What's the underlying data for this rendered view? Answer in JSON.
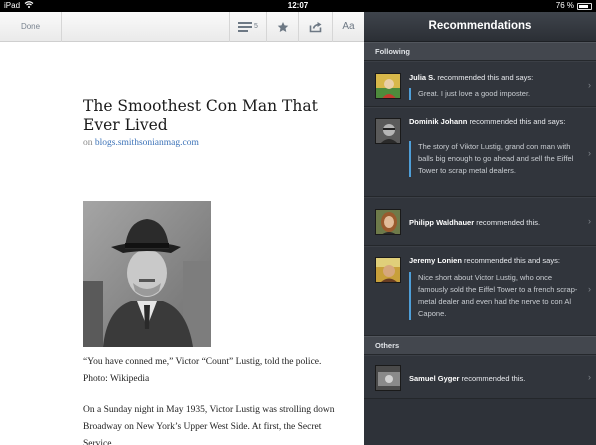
{
  "status_bar": {
    "device": "iPad",
    "time": "12:07",
    "battery": "76 %"
  },
  "toolbar": {
    "done_label": "Done",
    "list_count": "5",
    "font_label": "Aa"
  },
  "article": {
    "title": "The Smoothest Con Man That Ever Lived",
    "source_prefix": "on",
    "source_domain": "blogs.smithsonianmag.com",
    "caption": "“You have conned me,” Victor “Count” Lustig, told the police. Photo: Wikipedia",
    "body": "On a Sunday night in May 1935, Victor Lustig was strolling down Broadway on New York’s Upper West Side. At first, the Secret Service"
  },
  "recommendations": {
    "header": "Recommendations",
    "following_label": "Following",
    "others_label": "Others",
    "following": [
      {
        "name": "Julia S.",
        "action": "recommended this and says:",
        "quote": "Great. I just love a good imposter."
      },
      {
        "name": "Dominik Johann",
        "action": "recommended this and says:",
        "quote": "The story of Viktor Lustig, grand con man with balls big enough to go ahead and sell the Eiffel Tower to scrap metal dealers."
      },
      {
        "name": "Philipp Waldhauer",
        "action": "recommended this.",
        "quote": ""
      },
      {
        "name": "Jeremy Lonien",
        "action": "recommended this and says:",
        "quote": "Nice short about Victor Lustig, who once famously sold the Eiffel Tower to a french scrap-metal dealer and even had the nerve to con Al Capone."
      }
    ],
    "others": [
      {
        "name": "Samuel Gyger",
        "action": "recommended this."
      }
    ]
  },
  "icons": {
    "wifi": "wifi-icon",
    "list": "list-icon",
    "star": "star-icon",
    "share": "share-icon",
    "chevron": "chevron-right-icon"
  },
  "colors": {
    "panel_bg": "#2e3239",
    "quote_bar": "#4f9fd8",
    "link": "#3d73b8"
  }
}
